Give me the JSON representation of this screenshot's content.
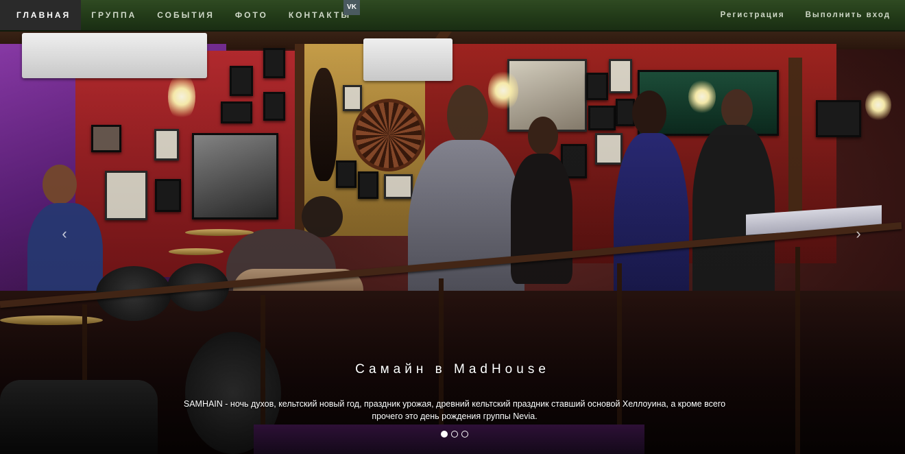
{
  "nav": {
    "items": [
      {
        "label": "ГЛАВНАЯ",
        "active": true
      },
      {
        "label": "ГРУППА",
        "active": false
      },
      {
        "label": "СОБЫТИЯ",
        "active": false
      },
      {
        "label": "ФОТО",
        "active": false
      },
      {
        "label": "КОНТАКТЫ",
        "active": false
      }
    ],
    "social_icon": "vk-icon",
    "social_label": "VK",
    "register": "Регистрация",
    "login": "Выполнить вход"
  },
  "carousel": {
    "prev_icon": "chevron-left-icon",
    "next_icon": "chevron-right-icon",
    "prev_glyph": "‹",
    "next_glyph": "›",
    "slide_count": 3,
    "active_index": 0,
    "caption_title": "Самайн в MadHouse",
    "caption_text": "SAMHAIN - ночь духов, кельтский новый год, праздник урожая, древний кельтский праздник ставший основой Хеллоуина, а кроме всего прочего это день рождения группы Nevia."
  },
  "colors": {
    "navbar": "#223a18",
    "active_nav": "#2a2a2a",
    "text": "#ffffff"
  }
}
